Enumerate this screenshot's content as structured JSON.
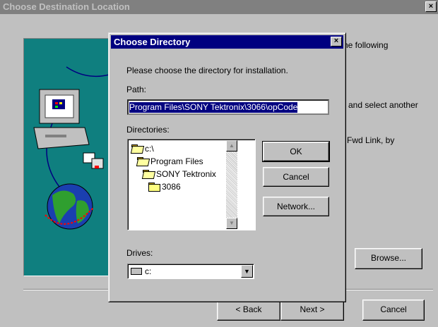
{
  "background_dialog": {
    "title": "Choose Destination Location",
    "text_1": "he following",
    "text_2": "and select another",
    "text_3": "Fwd Link, by",
    "browse_label": "Browse...",
    "back_label": "< Back",
    "next_label": "Next >",
    "cancel_label": "Cancel"
  },
  "dialog": {
    "title": "Choose Directory",
    "close_symbol": "×",
    "instruction": "Please choose the directory for installation.",
    "path_label": "Path:",
    "path_value": "Program Files\\SONY Tektronix\\3066\\opCode",
    "directories_label": "Directories:",
    "directories": [
      {
        "name": "c:\\",
        "icon": "open-folder-icon"
      },
      {
        "name": "Program Files",
        "icon": "open-folder-icon"
      },
      {
        "name": "SONY Tektronix",
        "icon": "open-folder-icon"
      },
      {
        "name": "3086",
        "icon": "folder-icon"
      }
    ],
    "drives_label": "Drives:",
    "drives_value": "c:",
    "ok_label": "OK",
    "cancel_label": "Cancel",
    "network_label": "Network..."
  },
  "colors": {
    "title_active": "#000080",
    "title_inactive": "#808080",
    "face": "#c0c0c0",
    "illustration_bg": "#0f7f7f"
  }
}
